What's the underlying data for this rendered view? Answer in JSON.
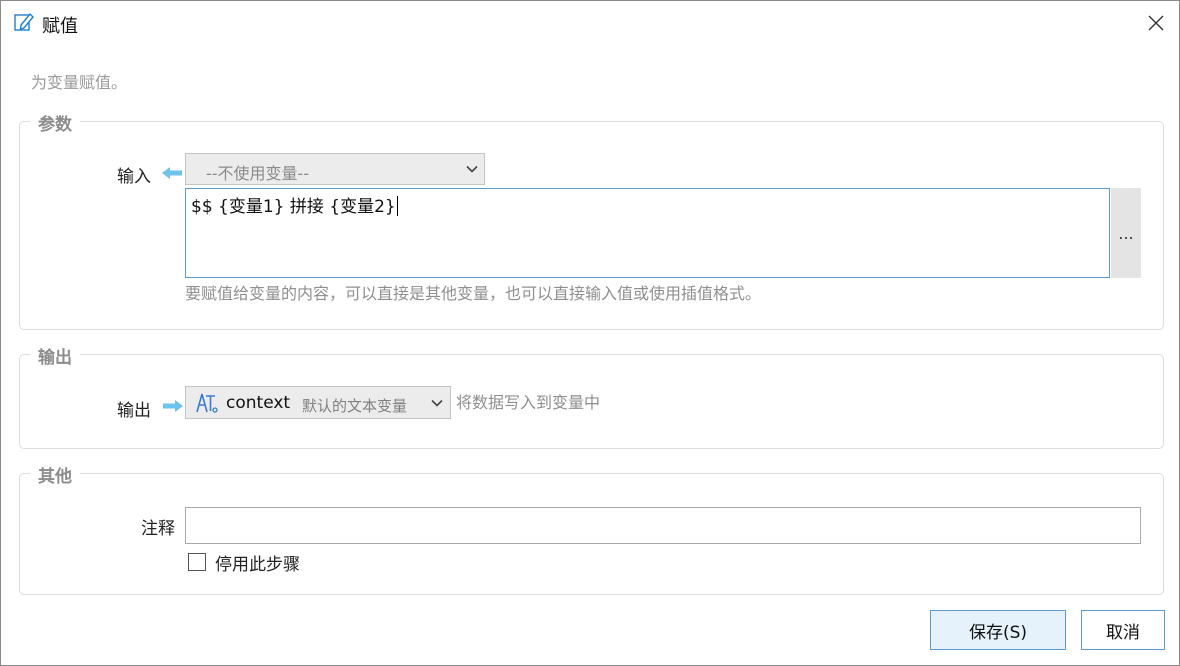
{
  "window": {
    "title": "赋值",
    "description": "为变量赋值。"
  },
  "params_group": {
    "title": "参数",
    "input_label": "输入",
    "variable_select": {
      "value": "--不使用变量--"
    },
    "expression": {
      "value": "$$ {变量1} 拼接 {变量2}"
    },
    "more_button": "...",
    "hint": "要赋值给变量的内容，可以直接是其他变量，也可以直接输入值或使用插值格式。"
  },
  "output_group": {
    "title": "输出",
    "output_label": "输出",
    "variable": {
      "name": "context",
      "description": "默认的文本变量"
    },
    "hint": "将数据写入到变量中"
  },
  "other_group": {
    "title": "其他",
    "comment_label": "注释",
    "comment_value": "",
    "disable_checkbox": {
      "label": "停用此步骤",
      "checked": false
    }
  },
  "buttons": {
    "save": "保存(S)",
    "cancel": "取消"
  },
  "colors": {
    "accent": "#5b9bd5",
    "arrow": "#6cc3ee",
    "group_title": "#8c8c8c",
    "hint_text": "#8f8f8f"
  },
  "icons": [
    "edit-icon",
    "close-icon",
    "arrow-left-icon",
    "arrow-right-icon",
    "chevron-down-icon",
    "text-variable-icon",
    "checkbox-icon"
  ]
}
